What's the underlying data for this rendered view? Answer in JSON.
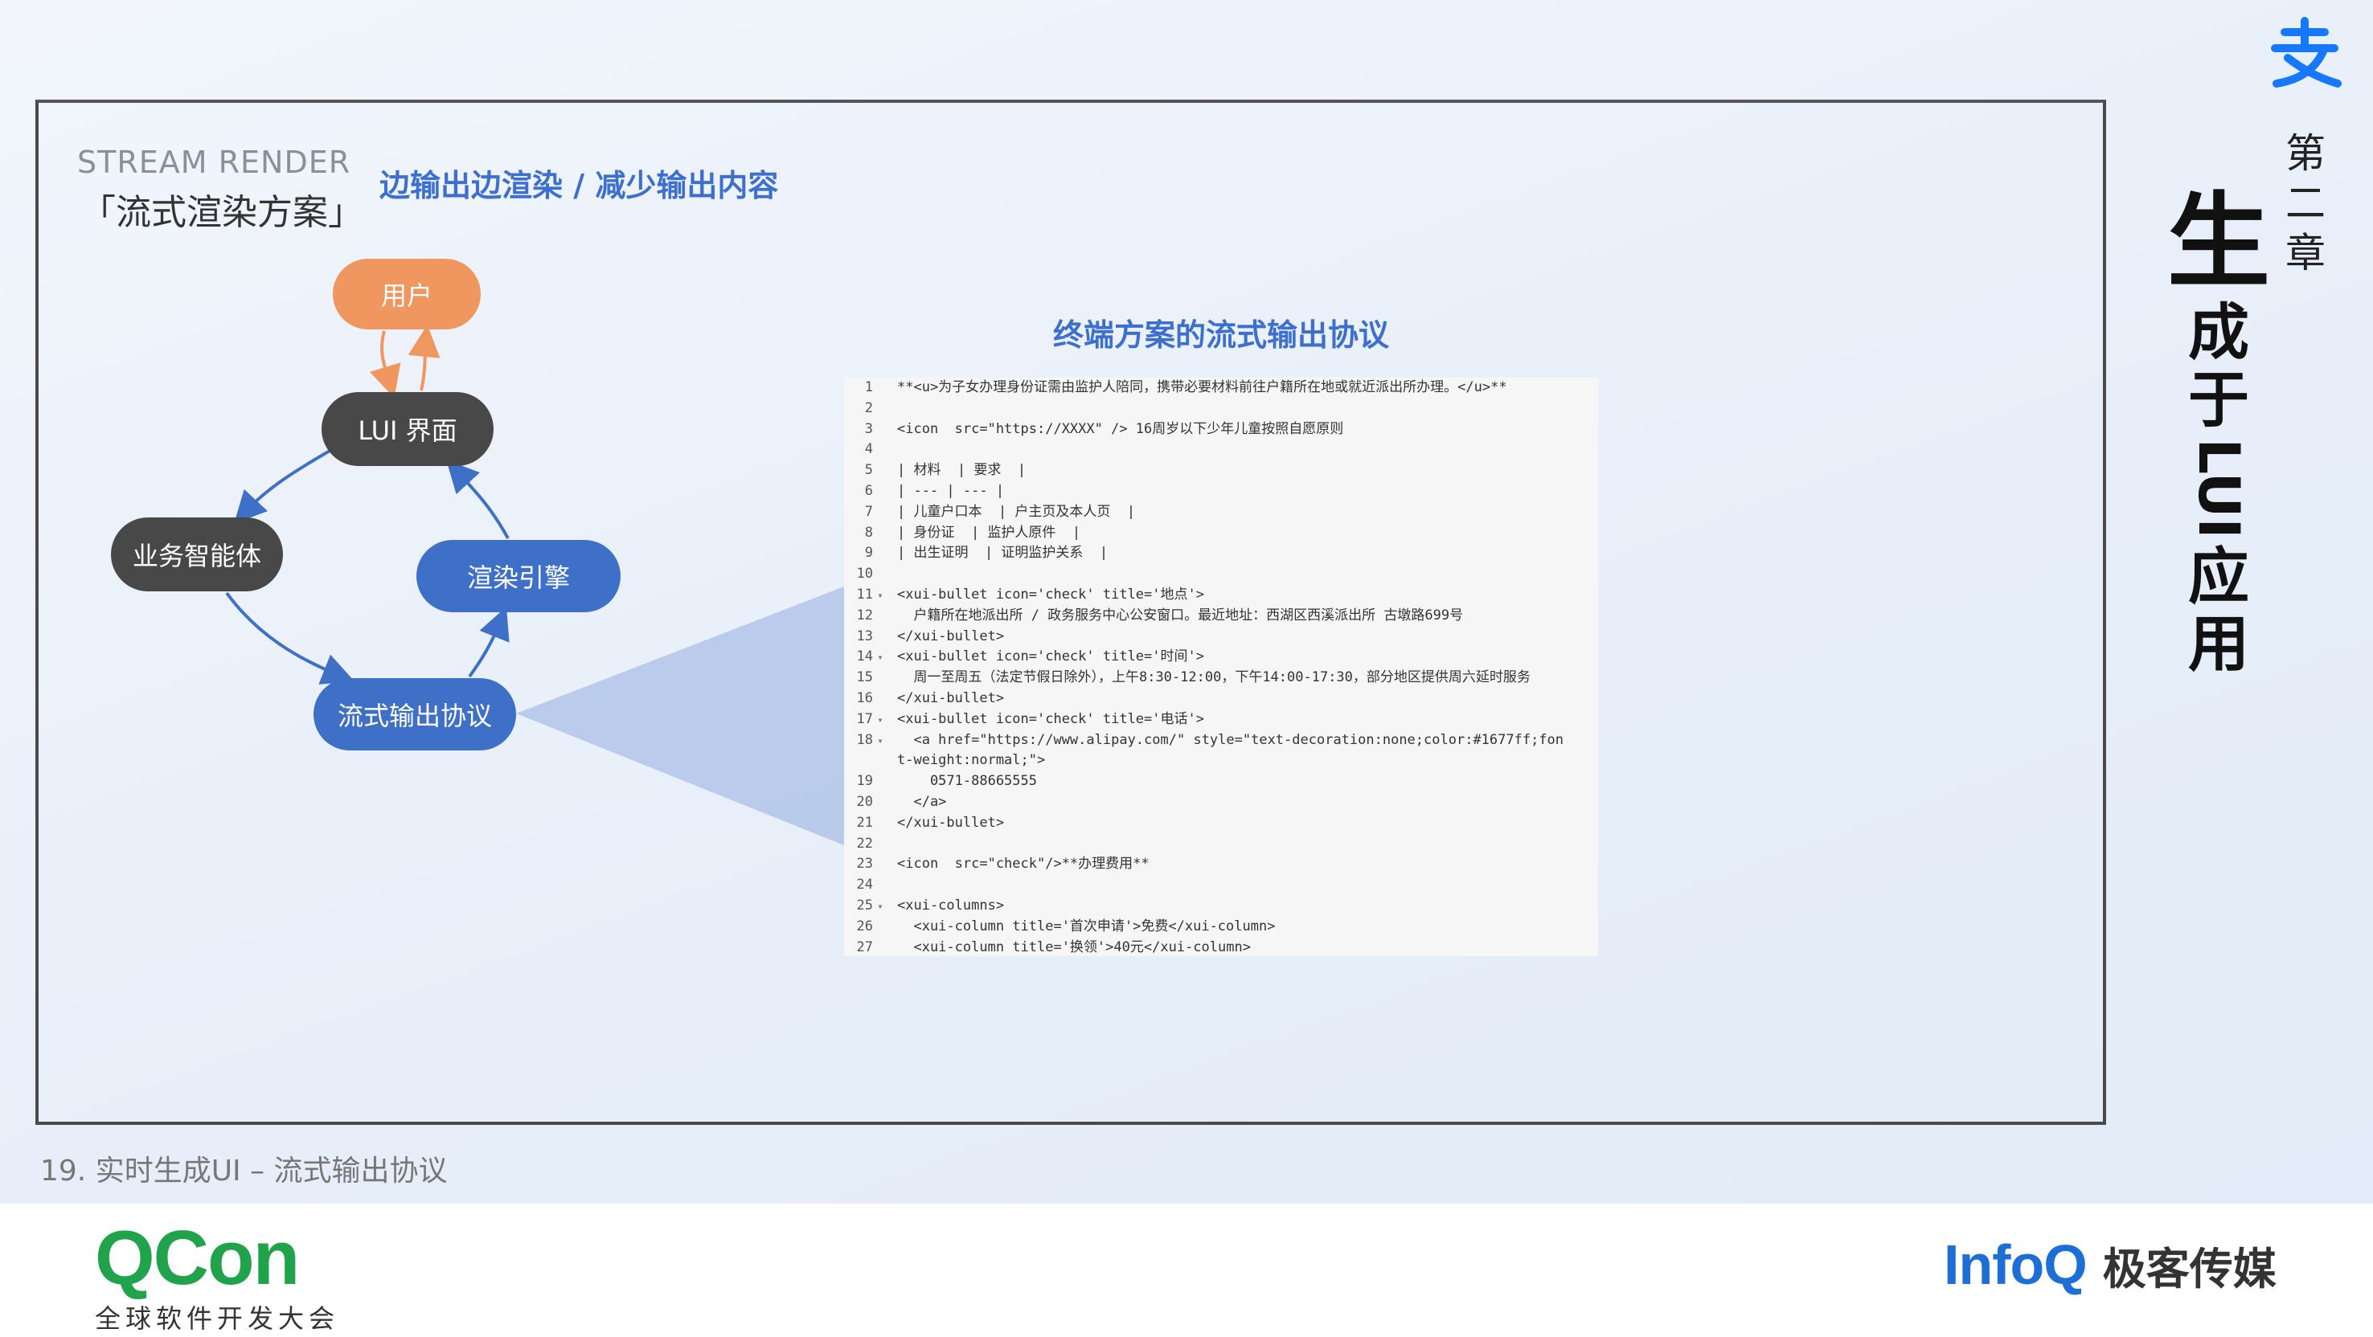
{
  "header": {
    "section_en": "STREAM RENDER",
    "section_zh": "「流式渲染方案」",
    "headline": "边输出边渲染 / 减少输出内容"
  },
  "diagram": {
    "nodes": {
      "user": "用户",
      "lui": "LUI 界面",
      "agent": "业务智能体",
      "engine": "渲染引擎",
      "stream": "流式输出协议"
    },
    "colors": {
      "user": "#f0965f",
      "dark": "#484848",
      "blue": "#3f70c8",
      "arrow_orange": "#f0965f",
      "arrow_blue": "#3f70c8"
    }
  },
  "code_panel": {
    "title": "终端方案的流式输出协议",
    "lines": [
      {
        "n": "1",
        "fold": "",
        "text": "**<u>为子女办理身份证需由监护人陪同，携带必要材料前往户籍所在地或就近派出所办理。</u>**"
      },
      {
        "n": "2",
        "fold": "",
        "text": ""
      },
      {
        "n": "3",
        "fold": "",
        "text": "<icon  src=\"https://XXXX\" /> 16周岁以下少年儿童按照自愿原则"
      },
      {
        "n": "4",
        "fold": "",
        "text": ""
      },
      {
        "n": "5",
        "fold": "",
        "text": "| 材料  | 要求  |"
      },
      {
        "n": "6",
        "fold": "",
        "text": "| --- | --- |"
      },
      {
        "n": "7",
        "fold": "",
        "text": "| 儿童户口本  | 户主页及本人页  |"
      },
      {
        "n": "8",
        "fold": "",
        "text": "| 身份证  | 监护人原件  |"
      },
      {
        "n": "9",
        "fold": "",
        "text": "| 出生证明  | 证明监护关系  |"
      },
      {
        "n": "10",
        "fold": "",
        "text": ""
      },
      {
        "n": "11",
        "fold": "▾",
        "text": "<xui-bullet icon='check' title='地点'>"
      },
      {
        "n": "12",
        "fold": "",
        "text": "  户籍所在地派出所 / 政务服务中心公安窗口。最近地址：西湖区西溪派出所 古墩路699号"
      },
      {
        "n": "13",
        "fold": "",
        "text": "</xui-bullet>"
      },
      {
        "n": "14",
        "fold": "▾",
        "text": "<xui-bullet icon='check' title='时间'>"
      },
      {
        "n": "15",
        "fold": "",
        "text": "  周一至周五（法定节假日除外），上午8:30-12:00，下午14:00-17:30，部分地区提供周六延时服务"
      },
      {
        "n": "16",
        "fold": "",
        "text": "</xui-bullet>"
      },
      {
        "n": "17",
        "fold": "▾",
        "text": "<xui-bullet icon='check' title='电话'>"
      },
      {
        "n": "18",
        "fold": "▾",
        "text": "  <a href=\"https://www.alipay.com/\" style=\"text-decoration:none;color:#1677ff;fon"
      },
      {
        "n": "",
        "fold": "",
        "text": "t-weight:normal;\">"
      },
      {
        "n": "19",
        "fold": "",
        "text": "    0571-88665555"
      },
      {
        "n": "20",
        "fold": "",
        "text": "  </a>"
      },
      {
        "n": "21",
        "fold": "",
        "text": "</xui-bullet>"
      },
      {
        "n": "22",
        "fold": "",
        "text": ""
      },
      {
        "n": "23",
        "fold": "",
        "text": "<icon  src=\"check\"/>**办理费用**"
      },
      {
        "n": "24",
        "fold": "",
        "text": ""
      },
      {
        "n": "25",
        "fold": "▾",
        "text": "<xui-columns>"
      },
      {
        "n": "26",
        "fold": "",
        "text": "  <xui-column title='首次申请'>免费</xui-column>"
      },
      {
        "n": "27",
        "fold": "",
        "text": "  <xui-column title='换领'>40元</xui-column>"
      }
    ]
  },
  "chapter": {
    "label": "第二章",
    "title_big": "生",
    "title_rest": [
      "成",
      "于",
      "LUI",
      "应",
      "用"
    ]
  },
  "caption": "19. 实时生成UI – 流式输出协议",
  "footer": {
    "qcon_word": "QCon",
    "qcon_sub": "全球软件开发大会",
    "infoq_word": "InfoQ",
    "infoq_media": "极客传媒",
    "alipay_logo_icon": "alipay-zhi-icon"
  }
}
